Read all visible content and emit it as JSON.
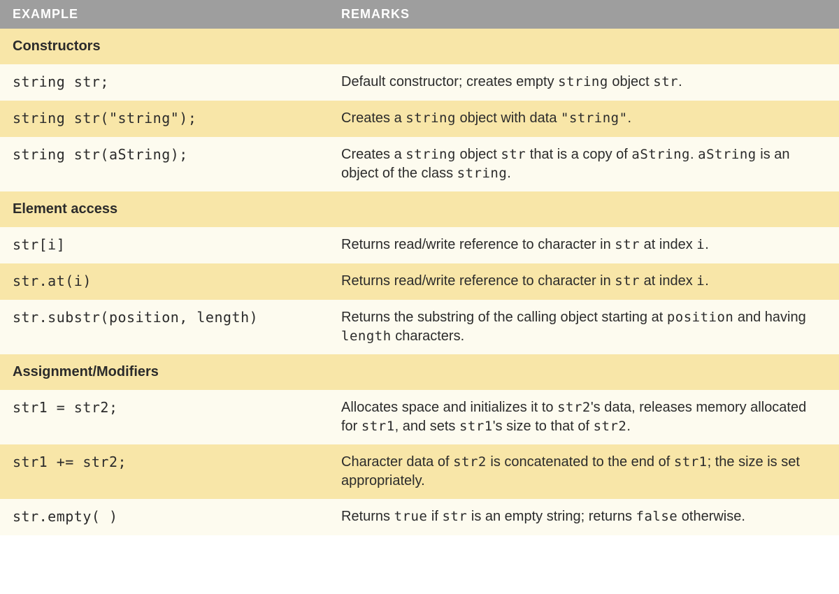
{
  "headers": {
    "example": "EXAMPLE",
    "remarks": "REMARKS"
  },
  "sections": [
    {
      "title": "Constructors",
      "rows": [
        {
          "shade": "light",
          "example": [
            {
              "t": "code",
              "v": "string str;"
            }
          ],
          "remarks": [
            {
              "t": "text",
              "v": "Default constructor; creates empty "
            },
            {
              "t": "code",
              "v": "string"
            },
            {
              "t": "text",
              "v": " object "
            },
            {
              "t": "code",
              "v": "str"
            },
            {
              "t": "text",
              "v": "."
            }
          ]
        },
        {
          "shade": "shade",
          "example": [
            {
              "t": "code",
              "v": "string str(\"string\");"
            }
          ],
          "remarks": [
            {
              "t": "text",
              "v": "Creates a "
            },
            {
              "t": "code",
              "v": "string"
            },
            {
              "t": "text",
              "v": " object with data "
            },
            {
              "t": "code",
              "v": "\"string\""
            },
            {
              "t": "text",
              "v": "."
            }
          ]
        },
        {
          "shade": "light",
          "example": [
            {
              "t": "code",
              "v": "string str(aString);"
            }
          ],
          "remarks": [
            {
              "t": "text",
              "v": "Creates a "
            },
            {
              "t": "code",
              "v": "string"
            },
            {
              "t": "text",
              "v": " object "
            },
            {
              "t": "code",
              "v": "str"
            },
            {
              "t": "text",
              "v": " that is a copy of "
            },
            {
              "t": "code",
              "v": "aString"
            },
            {
              "t": "text",
              "v": ". "
            },
            {
              "t": "code",
              "v": "aString"
            },
            {
              "t": "text",
              "v": " is an object of the class "
            },
            {
              "t": "code",
              "v": "string"
            },
            {
              "t": "text",
              "v": "."
            }
          ]
        }
      ]
    },
    {
      "title": "Element access",
      "rows": [
        {
          "shade": "light",
          "example": [
            {
              "t": "code",
              "v": "str[i]"
            }
          ],
          "remarks": [
            {
              "t": "text",
              "v": "Returns read/write reference to character in "
            },
            {
              "t": "code",
              "v": "str"
            },
            {
              "t": "text",
              "v": " at index "
            },
            {
              "t": "code",
              "v": "i"
            },
            {
              "t": "text",
              "v": "."
            }
          ]
        },
        {
          "shade": "shade",
          "example": [
            {
              "t": "code",
              "v": "str.at(i)"
            }
          ],
          "remarks": [
            {
              "t": "text",
              "v": "Returns read/write reference to character in "
            },
            {
              "t": "code",
              "v": "str"
            },
            {
              "t": "text",
              "v": " at index "
            },
            {
              "t": "code",
              "v": "i"
            },
            {
              "t": "text",
              "v": "."
            }
          ]
        },
        {
          "shade": "light",
          "example": [
            {
              "t": "code",
              "v": "str.substr(position, length)"
            }
          ],
          "remarks": [
            {
              "t": "text",
              "v": "Returns the substring of the calling object starting at "
            },
            {
              "t": "code",
              "v": "position"
            },
            {
              "t": "text",
              "v": " and having "
            },
            {
              "t": "code",
              "v": "length"
            },
            {
              "t": "text",
              "v": " characters."
            }
          ]
        }
      ]
    },
    {
      "title": "Assignment/Modifiers",
      "rows": [
        {
          "shade": "light",
          "example": [
            {
              "t": "code",
              "v": "str1 = str2;"
            }
          ],
          "remarks": [
            {
              "t": "text",
              "v": "Allocates space and initializes it to "
            },
            {
              "t": "code",
              "v": "str2"
            },
            {
              "t": "text",
              "v": "'s data, releases memory allocated for "
            },
            {
              "t": "code",
              "v": "str1"
            },
            {
              "t": "text",
              "v": ", and sets "
            },
            {
              "t": "code",
              "v": "str1"
            },
            {
              "t": "text",
              "v": "'s size to that of "
            },
            {
              "t": "code",
              "v": "str2"
            },
            {
              "t": "text",
              "v": "."
            }
          ]
        },
        {
          "shade": "shade",
          "example": [
            {
              "t": "code",
              "v": "str1 += str2;"
            }
          ],
          "remarks": [
            {
              "t": "text",
              "v": "Character data of "
            },
            {
              "t": "code",
              "v": "str2"
            },
            {
              "t": "text",
              "v": " is concatenated to the end of "
            },
            {
              "t": "code",
              "v": "str1"
            },
            {
              "t": "text",
              "v": "; the size is set appropriately."
            }
          ]
        },
        {
          "shade": "light",
          "example": [
            {
              "t": "code",
              "v": "str.empty( )"
            }
          ],
          "remarks": [
            {
              "t": "text",
              "v": "Returns "
            },
            {
              "t": "code",
              "v": "true"
            },
            {
              "t": "text",
              "v": " if "
            },
            {
              "t": "code",
              "v": "str"
            },
            {
              "t": "text",
              "v": " is an empty string; returns "
            },
            {
              "t": "code",
              "v": "false"
            },
            {
              "t": "text",
              "v": " otherwise."
            }
          ]
        }
      ]
    }
  ]
}
